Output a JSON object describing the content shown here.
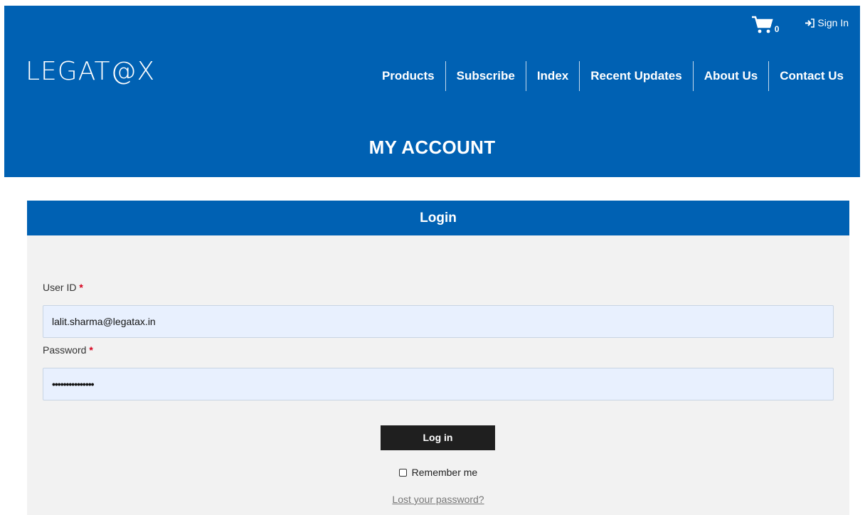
{
  "brand": {
    "logo_text": "LEGAT@X"
  },
  "topbar": {
    "cart_icon": "shopping-cart-icon",
    "cart_count": "0",
    "signin_icon": "sign-in-icon",
    "signin_label": "Sign In"
  },
  "nav": {
    "items": [
      "Products",
      "Subscribe",
      "Index",
      "Recent Updates",
      "About Us",
      "Contact Us"
    ]
  },
  "page": {
    "title": "MY ACCOUNT"
  },
  "login": {
    "header": "Login",
    "userid_label": "User ID",
    "required_mark": "*",
    "userid_value": "lalit.sharma@legatax.in",
    "password_label": "Password",
    "password_value": "•••••••••••••••",
    "button_label": "Log in",
    "remember_label": "Remember me",
    "lost_password_link": "Lost your password?"
  },
  "colors": {
    "brand_blue": "#0061b3",
    "button_dark": "#1f1f1f",
    "required_red": "#d6001c",
    "field_bg": "#e8f0fe"
  }
}
